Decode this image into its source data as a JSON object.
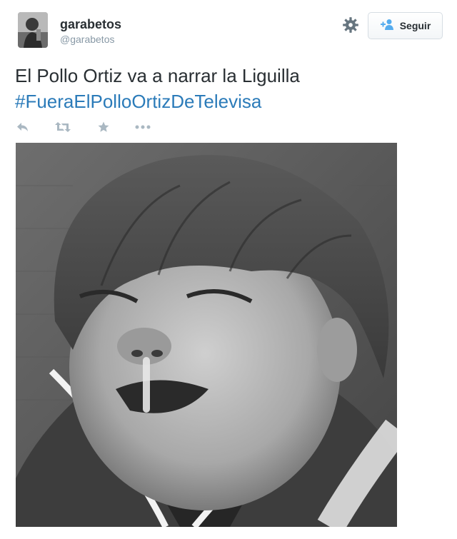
{
  "tweet": {
    "user": {
      "name": "garabetos",
      "handle": "@garabetos"
    },
    "follow_label": "Seguir",
    "text_line1": "El Pollo Ortiz va a narrar la Liguilla",
    "hashtag": "#FueraElPolloOrtizDeTelevisa",
    "icons": {
      "settings": "gear-icon",
      "follow": "add-user-icon",
      "reply": "reply-icon",
      "retweet": "retweet-icon",
      "favorite": "star-icon",
      "more": "more-icon"
    },
    "colors": {
      "hashtag": "#2b7bb9",
      "icon": "#aab8c2",
      "follow_icon": "#55acee",
      "text": "#292f33",
      "handle": "#8899a6"
    }
  }
}
